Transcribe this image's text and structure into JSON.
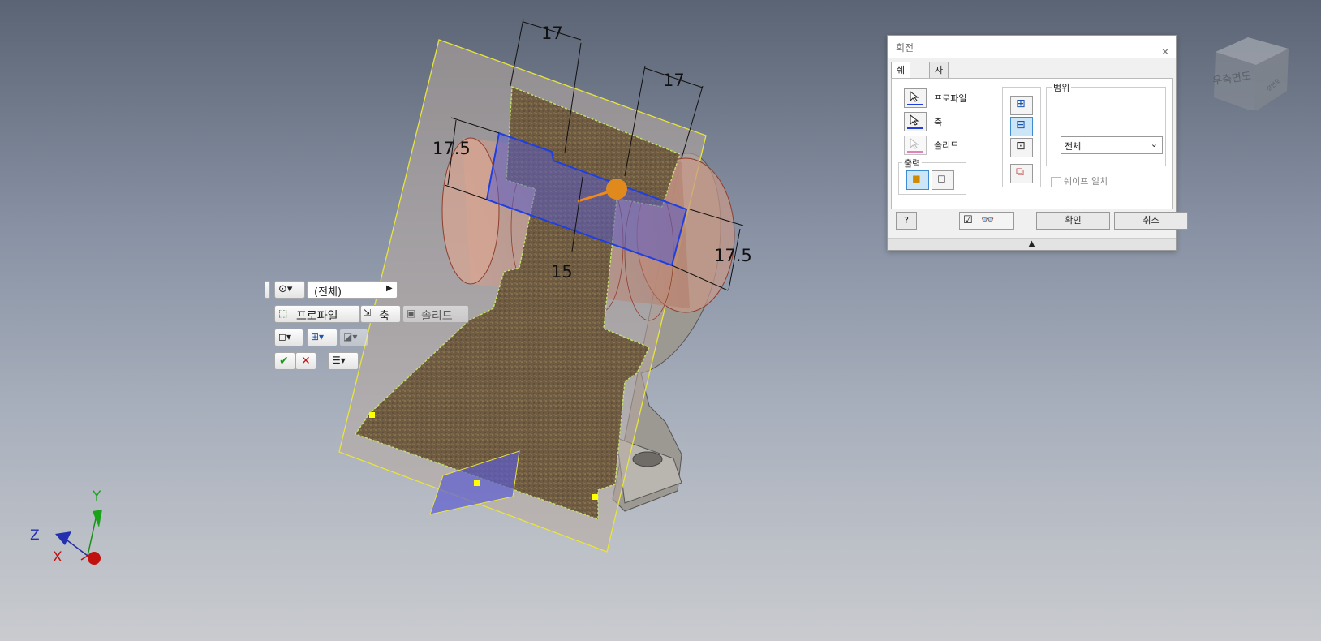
{
  "dimensions": {
    "top_left": "17",
    "top_right": "17",
    "left": "17.5",
    "right": "17.5",
    "center": "15"
  },
  "minitoolbar": {
    "extent_value": "(전체)",
    "profile_label": "프로파일",
    "axis_label": "축",
    "solid_label": "솔리드"
  },
  "dialog": {
    "title": "회전",
    "tabs": [
      "쉐이프",
      "자세히"
    ],
    "profile_label": "프로파일",
    "axis_label": "축",
    "solid_label": "솔리드",
    "output_group": "출력",
    "extent_group": "범위",
    "extent_value": "전체",
    "match_shape": "쉐이프 일치",
    "ok_label": "확인",
    "cancel_label": "취소"
  },
  "viewcube": {
    "face_label": "우측면도",
    "side_label": "정면도"
  },
  "triad": {
    "x": "X",
    "y": "Y",
    "z": "Z"
  },
  "colors": {
    "sketch_yellow": "#ffff00",
    "preview_blue": "#1f3fe0",
    "axis_orange": "#f08a1a",
    "part_grey": "#c8c5be",
    "section_brown": "#6b5840"
  }
}
